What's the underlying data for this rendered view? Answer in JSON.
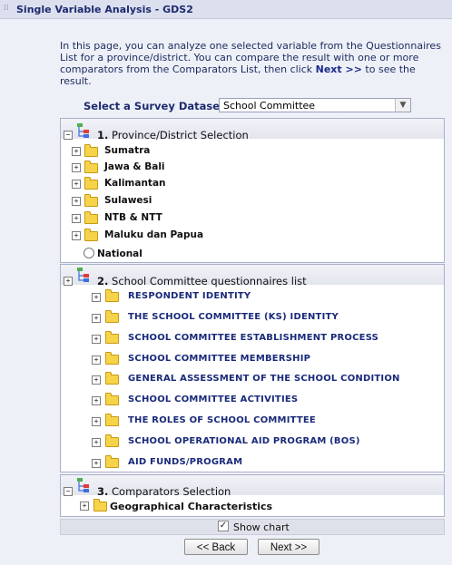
{
  "window": {
    "title": "Single Variable Analysis - GDS2"
  },
  "intro": {
    "text_before": "In this page, you can analyze one selected variable from the Questionnaires List for a province/district. You can compare the result with one or more comparators from the Comparators List, then click ",
    "next_ref": "Next >>",
    "text_after": " to see the result."
  },
  "dataset": {
    "label": "Select a Survey Dataset:",
    "value": "School Committee"
  },
  "section1": {
    "number": "1.",
    "title": "Province/District Selection",
    "items": [
      "Sumatra",
      "Jawa & Bali",
      "Kalimantan",
      "Sulawesi",
      "NTB & NTT",
      "Maluku dan Papua"
    ],
    "national": "National"
  },
  "section2": {
    "number": "2.",
    "title": "School Committee questionnaires list",
    "items": [
      "RESPONDENT IDENTITY",
      "THE SCHOOL COMMITTEE (KS) IDENTITY",
      "SCHOOL COMMITTEE ESTABLISHMENT PROCESS",
      "SCHOOL COMMITTEE MEMBERSHIP",
      "GENERAL ASSESSMENT OF THE SCHOOL CONDITION",
      "SCHOOL COMMITTEE ACTIVITIES",
      "THE ROLES OF SCHOOL COMMITTEE",
      "SCHOOL OPERATIONAL AID PROGRAM (BOS)",
      "AID FUNDS/PROGRAM"
    ]
  },
  "section3": {
    "number": "3.",
    "title": "Comparators Selection",
    "items": [
      "Geographical Characteristics"
    ]
  },
  "show_chart": {
    "label": "Show chart",
    "checked": true
  },
  "buttons": {
    "back": "<< Back",
    "next": "Next >>"
  },
  "icons": {
    "expand": "plus-box-icon",
    "collapse": "minus-box-icon",
    "folder": "folder-icon",
    "section": "hierarchy-icon"
  },
  "colors": {
    "folder": "#f7d34a",
    "heading": "#1d2b6e",
    "question": "#1a2a7a"
  }
}
